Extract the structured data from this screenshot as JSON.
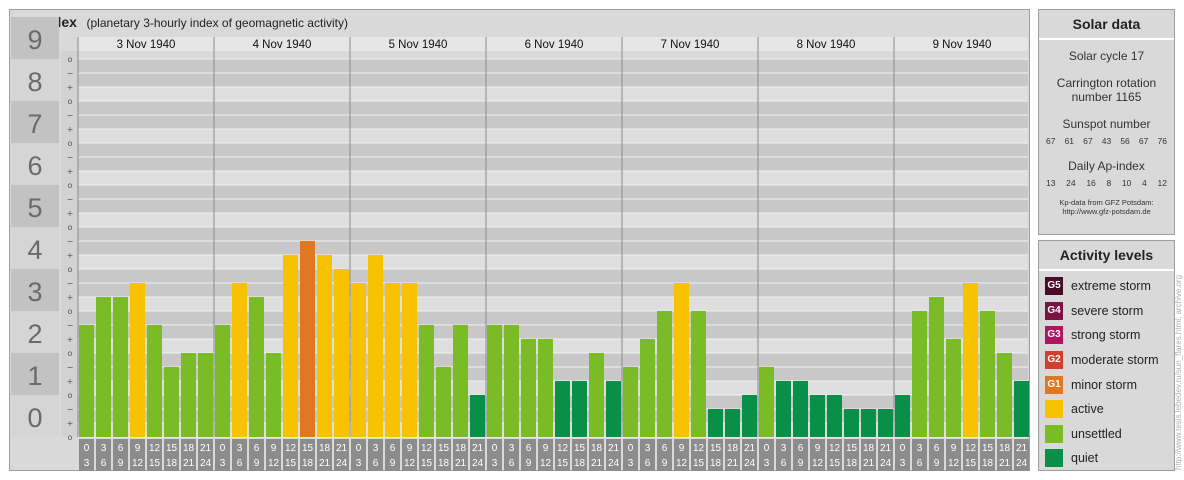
{
  "header": {
    "title": "Kp-index",
    "subtitle": "(planetary 3-hourly index of geomagnetic activity)"
  },
  "chart_data": {
    "type": "bar",
    "y_axis_labels": [
      "0",
      "1",
      "2",
      "3",
      "4",
      "5",
      "6",
      "7",
      "8",
      "9"
    ],
    "ylim": [
      0,
      9
    ],
    "sub_tick_labels": [
      "o",
      "+",
      "−"
    ],
    "days": [
      "3 Nov 1940",
      "4 Nov 1940",
      "5 Nov 1940",
      "6 Nov 1940",
      "7 Nov 1940",
      "8 Nov 1940",
      "9 Nov 1940"
    ],
    "interval_top": [
      "0",
      "3",
      "6",
      "9",
      "12",
      "15",
      "18",
      "21"
    ],
    "interval_bottom": [
      "3",
      "6",
      "9",
      "12",
      "15",
      "18",
      "21",
      "24"
    ],
    "values": [
      2.667,
      3.333,
      3.333,
      3.667,
      2.667,
      1.667,
      2.0,
      2.0,
      2.667,
      3.667,
      3.333,
      2.0,
      4.333,
      4.667,
      4.333,
      4.0,
      3.667,
      4.333,
      3.667,
      3.667,
      2.667,
      1.667,
      2.667,
      1.0,
      2.667,
      2.667,
      2.333,
      2.333,
      1.333,
      1.333,
      2.0,
      1.333,
      1.667,
      2.333,
      3.0,
      3.667,
      3.0,
      0.667,
      0.667,
      1.0,
      1.667,
      1.333,
      1.333,
      1.0,
      1.0,
      0.667,
      0.667,
      0.667,
      1.0,
      3.0,
      3.333,
      2.333,
      3.667,
      3.0,
      2.0,
      1.333
    ],
    "levels": [
      "unsettled",
      "unsettled",
      "unsettled",
      "active",
      "unsettled",
      "unsettled",
      "unsettled",
      "unsettled",
      "unsettled",
      "active",
      "unsettled",
      "unsettled",
      "active",
      "minor",
      "active",
      "active",
      "active",
      "active",
      "active",
      "active",
      "unsettled",
      "unsettled",
      "unsettled",
      "quiet",
      "unsettled",
      "unsettled",
      "unsettled",
      "unsettled",
      "quiet",
      "quiet",
      "unsettled",
      "quiet",
      "unsettled",
      "unsettled",
      "unsettled",
      "active",
      "unsettled",
      "quiet",
      "quiet",
      "quiet",
      "unsettled",
      "quiet",
      "quiet",
      "quiet",
      "quiet",
      "quiet",
      "quiet",
      "quiet",
      "quiet",
      "unsettled",
      "unsettled",
      "unsettled",
      "active",
      "unsettled",
      "unsettled",
      "quiet"
    ],
    "colors": {
      "quiet": "#0a8f48",
      "unsettled": "#79bc26",
      "active": "#f7c300",
      "minor": "#e07722",
      "band_dark": "#c8c8c8",
      "band_light": "#dedede",
      "label_box": "#8c8c8c",
      "y_box_dark": "#c2c2c2",
      "y_box_light": "#d5d5d5"
    }
  },
  "solar_data": {
    "title": "Solar data",
    "solar_cycle": "Solar cycle 17",
    "carrington": "Carrington rotation number 1165",
    "sunspot_title": "Sunspot number",
    "sunspot_values": [
      "67",
      "61",
      "67",
      "43",
      "56",
      "67",
      "76"
    ],
    "ap_title": "Daily Ap-index",
    "ap_values": [
      "13",
      "24",
      "16",
      "8",
      "10",
      "4",
      "12"
    ],
    "credit_line1": "Kp-data from GFZ Potsdam:",
    "credit_line2": "http://www.gfz-potsdam.de"
  },
  "activity_levels": {
    "title": "Activity levels",
    "items": [
      {
        "badge": "G5",
        "label": "extreme storm",
        "color": "#4a0a2a"
      },
      {
        "badge": "G4",
        "label": "severe storm",
        "color": "#7a1242"
      },
      {
        "badge": "G3",
        "label": "strong storm",
        "color": "#b0145e"
      },
      {
        "badge": "G2",
        "label": "moderate storm",
        "color": "#d0402c"
      },
      {
        "badge": "G1",
        "label": "minor storm",
        "color": "#e07722"
      },
      {
        "badge": "",
        "label": "active",
        "color": "#f7c300"
      },
      {
        "badge": "",
        "label": "unsettled",
        "color": "#79bc26"
      },
      {
        "badge": "",
        "label": "quiet",
        "color": "#0a8f48"
      }
    ]
  },
  "watermark": "http://www.tesis.lebedev.ru/sun_flares.html; archive.org"
}
